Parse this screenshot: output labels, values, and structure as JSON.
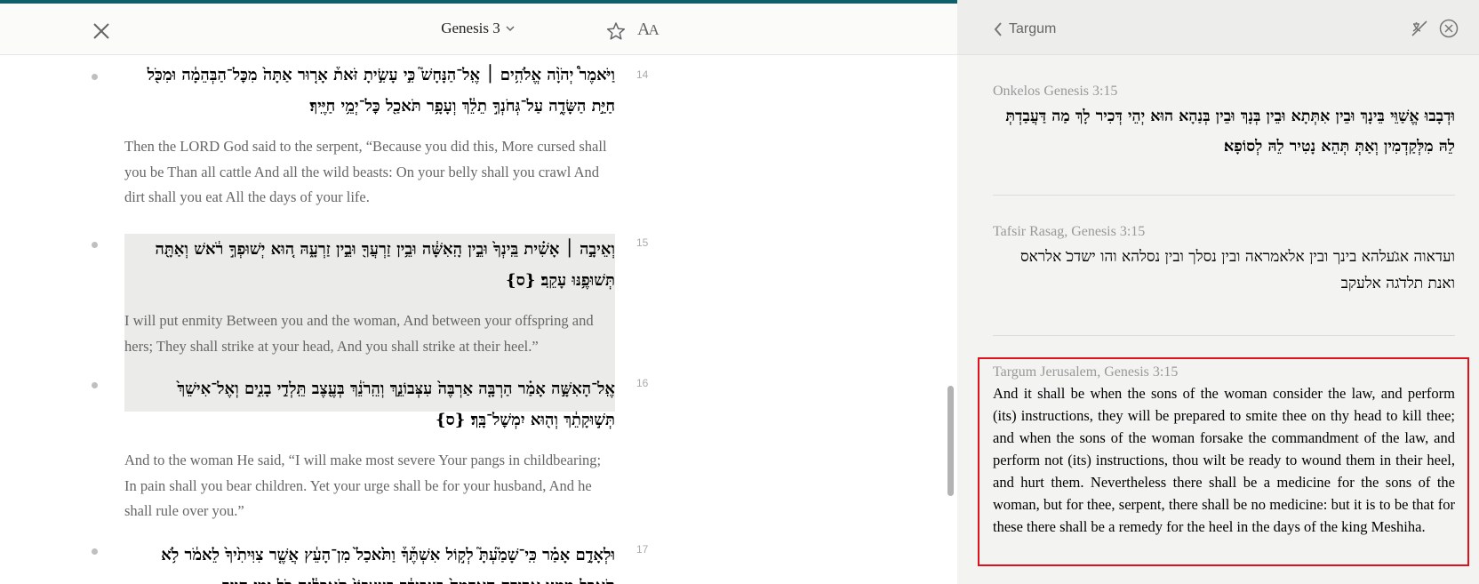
{
  "reader": {
    "title": "Genesis 3",
    "icons": {
      "close": "close-icon",
      "dropdown": "chevron-down-icon",
      "bookmark": "star-icon",
      "font": "font-size-icon"
    },
    "font_button_label": "A",
    "font_button_label_small": "A",
    "verses": [
      {
        "number": "14",
        "hebrew": "וַיֹּאמֶר֩ יְהֹוָ֨ה אֱלֹהִ֥ים ׀ אֶֽל־הַנָּחָשׁ֮ כִּ֣י עָשִׂ֣יתָ זֹּאת֒ אָר֤וּר אַתָּה֙ מִכׇּל־הַבְּהֵמָ֔ה וּמִכֹּ֖ל חַיַּ֣ת הַשָּׂדֶ֑ה עַל־גְּחֹנְךָ֣ תֵלֵ֔ךְ וְעָפָ֥ר תֹּאכַ֖ל כׇּל־יְמֵ֥י חַיֶּֽיךָ׃",
        "english": "Then the LORD God said to the serpent, “Because you did this, More cursed shall you be Than all cattle And all the wild beasts: On your belly shall you crawl And dirt shall you eat All the days of your life."
      },
      {
        "number": "15",
        "hebrew": "וְאֵיבָ֣ה ׀ אָשִׁ֗ית בֵּֽינְךָ֙ וּבֵ֣ין הָֽאִשָּׁ֔ה וּבֵ֥ין זַרְעֲךָ֖ וּבֵ֣ין זַרְעָ֑הּ ה֚וּא יְשׁוּפְךָ֣ רֹ֔אשׁ וְאַתָּ֖ה תְּשׁוּפֶ֥נּוּ עָקֵֽב׃ {ס}",
        "english": "I will put enmity Between you and the woman, And between your offspring and hers; They shall strike at your head, And you shall strike at their heel.”"
      },
      {
        "number": "16",
        "hebrew": "אֶֽל־הָאִשָּׁ֣ה אָמַ֗ר הַרְבָּ֤ה אַרְבֶּה֙ עִצְּבוֹנֵ֣ךְ וְהֵֽרֹנֵ֔ךְ בְּעֶ֖צֶב תֵּֽלְדִ֣י בָנִ֑ים וְאֶל־אִישֵׁךְ֙ תְּשׁ֣וּקָתֵ֔ךְ וְה֖וּא יִמְשׇׁל־בָּֽךְ׃ {ס}",
        "english": "And to the woman He said, “I will make most severe Your pangs in childbearing; In pain shall you bear children. Yet your urge shall be for your husband, And he shall rule over you.”"
      },
      {
        "number": "17",
        "hebrew": "וּלְאָדָ֣ם אָמַ֗ר כִּֽי־שָׁמַ֮עְתָּ֮ לְק֣וֹל אִשְׁתֶּ֒ךָ֒ וַתֹּ֙אכַל֙ מִן־הָעֵ֔ץ אֲשֶׁ֤ר צִוִּיתִ֙יךָ֙ לֵאמֹ֔ר לֹ֥א תֹאכַ֖ל מִמֶּ֑נּוּ אֲרוּרָ֤ה הָֽאֲדָמָה֙ בַּעֲבוּרֶ֔ךָ בְּעִצָּבוֹן֙ תֹּֽאכֲלֶ֔נָּה כֹּ֖ל יְמֵ֥י חַיֶּֽיךָ׃"
      }
    ]
  },
  "connections": {
    "back_label": "Targum",
    "icons": {
      "back": "chevron-left-icon",
      "translation": "translation-off-icon",
      "close": "close-circle-icon"
    },
    "results": [
      {
        "title": "Onkelos Genesis 3:15",
        "text": "וּדְבָבוּ אֱשַׁוֵּי בֵּינָךְ וּבֵין אִתְּתָא וּבֵין בְּנָךְ וּבֵין בְּנַהָא הוּא יְהֵי דְּכִיר לָךְ מַה דַּעֲבַדְתְּ לֵהּ מִלְּקַדְמִין וְאַתְּ תְּהֵא נָטִיר לֵהּ לְסוֹפָא׃"
      },
      {
        "title": "Tafsir Rasag, Genesis 3:15",
        "text": "ועדאוה אג̇עלהא בינך ובין אלאמראה ובין נסלך ובין נסלהא והו ישדכ̇ אלראס ואנת תלד̇גה אלעקב"
      },
      {
        "title": "Targum Jerusalem, Genesis 3:15",
        "text": "And it shall be when the sons of the woman consider the law, and perform (its) instructions, they will be prepared to smite thee on thy head to kill thee; and when the sons of the woman forsake the commandment of the law, and perform not (its) instructions, thou wilt be ready to wound them in their heel, and hurt them. Nevertheless there shall be a medicine for the sons of the woman, but for thee, serpent, there shall be no medicine: but it is to be that for these there shall be a remedy for the heel in the days of the king Meshiha."
      }
    ]
  }
}
